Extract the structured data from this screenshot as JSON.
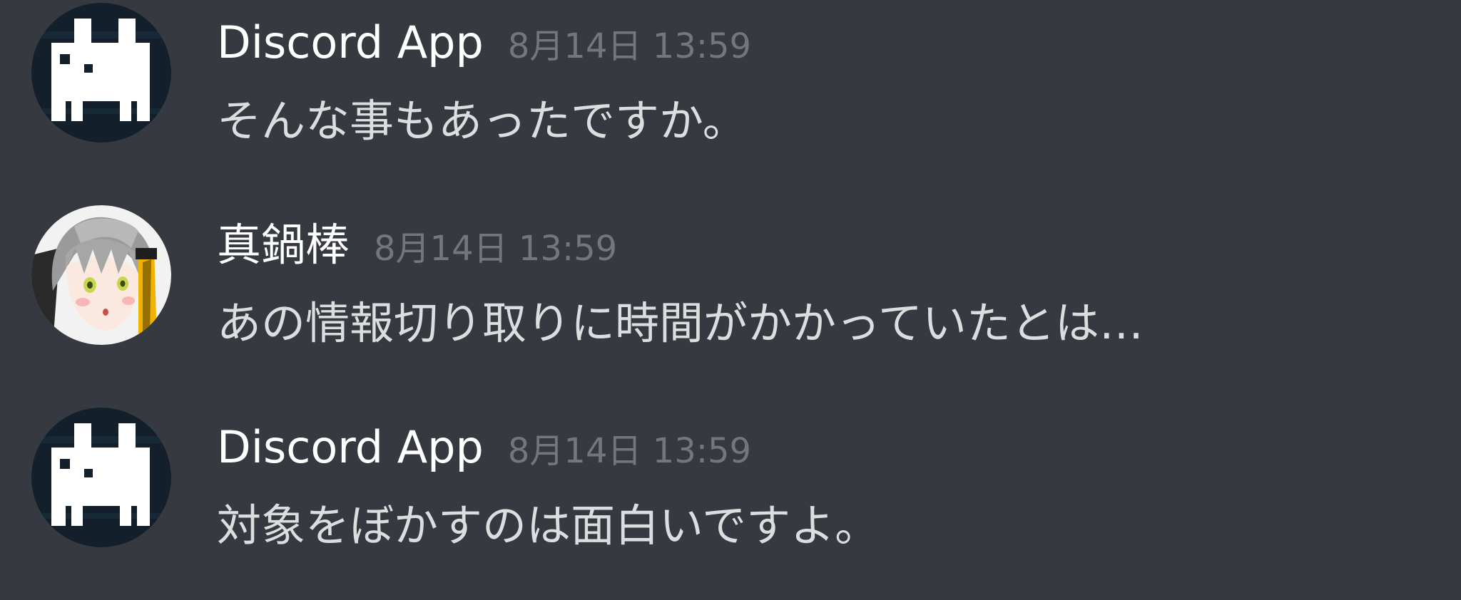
{
  "messages": [
    {
      "username": "Discord App",
      "timestamp": "8月14日 13:59",
      "content": "そんな事もあったですか。",
      "avatar_icon": "discord-bot-icon"
    },
    {
      "username": "真鍋棒",
      "timestamp": "8月14日 13:59",
      "content": "あの情報切り取りに時間がかかっていたとは…",
      "avatar_icon": "anime-girl-avatar"
    },
    {
      "username": "Discord App",
      "timestamp": "8月14日 13:59",
      "content": "対象をぼかすのは面白いですよ。",
      "avatar_icon": "discord-bot-icon"
    }
  ],
  "colors": {
    "background": "#36393f",
    "username": "#ffffff",
    "timestamp": "#72767d",
    "message_text": "#dcddde"
  }
}
